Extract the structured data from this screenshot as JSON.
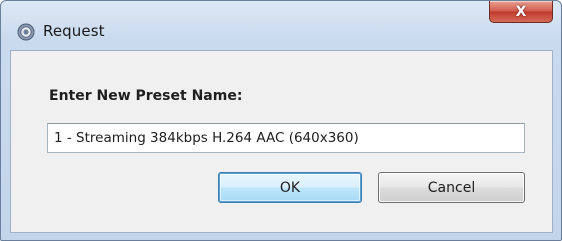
{
  "window": {
    "title": "Request",
    "close_glyph": "X",
    "app_icon": "settings-circle-icon"
  },
  "dialog": {
    "prompt": "Enter New Preset Name:",
    "input_value": "1 - Streaming 384kbps H.264 AAC (640x360)",
    "ok_label": "OK",
    "cancel_label": "Cancel"
  },
  "colors": {
    "titlebar": "#c9daee",
    "close_button": "#c0392b",
    "client_background": "#f0f0f0",
    "default_button_border": "#3c7fb1"
  }
}
